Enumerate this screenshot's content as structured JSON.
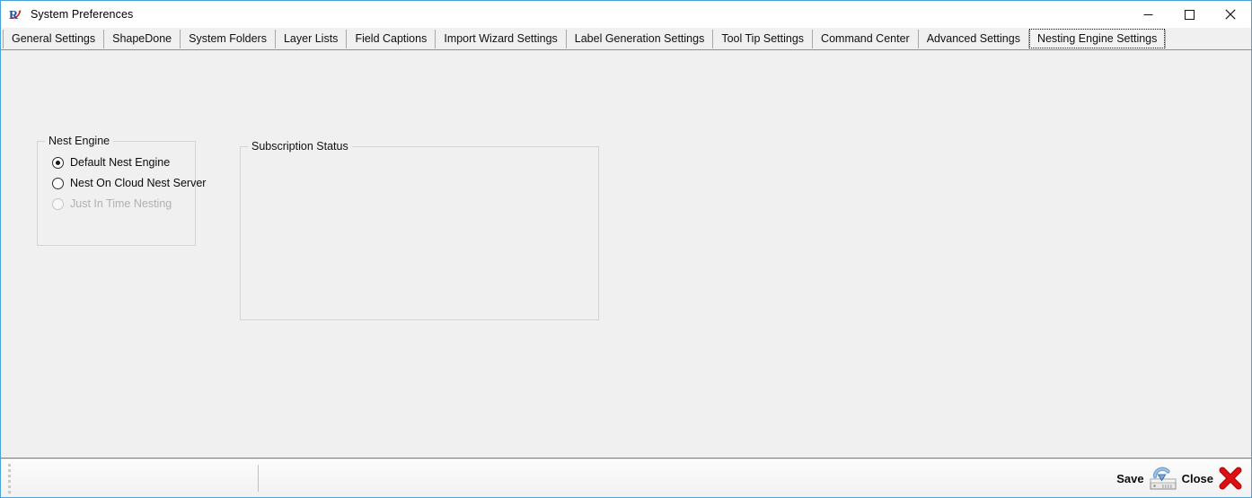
{
  "window": {
    "title": "System Preferences",
    "icon": "app-logo-r-icon",
    "border_color": "#4aa3d8",
    "controls": [
      {
        "name": "minimize",
        "glyph": "—"
      },
      {
        "name": "maximize",
        "glyph": "☐"
      },
      {
        "name": "close",
        "glyph": "✕"
      }
    ]
  },
  "tabs": {
    "selected": "Nesting Engine Settings",
    "items": [
      {
        "label": "General Settings"
      },
      {
        "label": "ShapeDone"
      },
      {
        "label": "System Folders"
      },
      {
        "label": "Layer Lists"
      },
      {
        "label": "Field Captions"
      },
      {
        "label": "Import Wizard Settings"
      },
      {
        "label": "Label Generation Settings"
      },
      {
        "label": "Tool Tip Settings"
      },
      {
        "label": "Command Center"
      },
      {
        "label": "Advanced Settings"
      },
      {
        "label": "Nesting Engine Settings"
      }
    ]
  },
  "main": {
    "nest_engine": {
      "legend": "Nest Engine",
      "options": [
        {
          "label": "Default Nest Engine",
          "checked": true,
          "disabled": false
        },
        {
          "label": "Nest On Cloud Nest Server",
          "checked": false,
          "disabled": false
        },
        {
          "label": "Just In Time Nesting",
          "checked": false,
          "disabled": true
        }
      ]
    },
    "subscription_status": {
      "legend": "Subscription Status",
      "content": ""
    }
  },
  "statusbar": {
    "grip": "grip-dots-icon",
    "save": {
      "label": "Save",
      "icon": "save-disk-icon"
    },
    "close": {
      "label": "Close",
      "icon": "red-x-icon"
    }
  },
  "colors": {
    "accent": "#4aa3d8",
    "face": "#f0f0f0",
    "groupbox_border": "#d4d4d4",
    "save_arrow": "#2f6fb5",
    "close_x": "#cc0000"
  }
}
